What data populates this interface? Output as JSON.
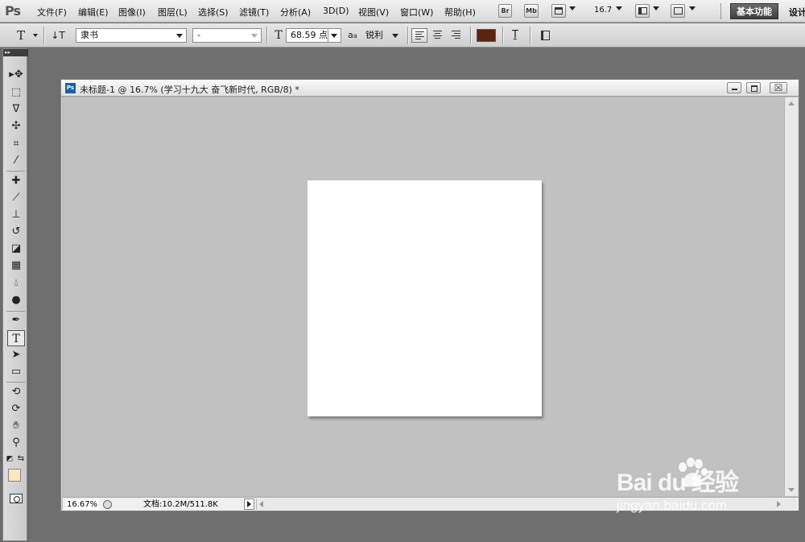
{
  "app": {
    "logo": "Ps"
  },
  "menu": {
    "items": [
      {
        "label": "文件(F)"
      },
      {
        "label": "编辑(E)"
      },
      {
        "label": "图像(I)"
      },
      {
        "label": "图层(L)"
      },
      {
        "label": "选择(S)"
      },
      {
        "label": "滤镜(T)"
      },
      {
        "label": "分析(A)"
      },
      {
        "label": "3D(D)"
      },
      {
        "label": "视图(V)"
      },
      {
        "label": "窗口(W)"
      },
      {
        "label": "帮助(H)"
      }
    ],
    "bridge_label": "Br",
    "minibridge_label": "Mb",
    "zoom_value": "16.7",
    "workspace_label": "基本功能",
    "design_label": "设计"
  },
  "options": {
    "tool_glyph": "T",
    "font_family": "隶书",
    "font_style": "-",
    "font_size": "68.59 点",
    "aa_label": "a",
    "aa_sub": "a",
    "antialias": "锐利",
    "text_color": "#5c2410"
  },
  "document": {
    "ps_icon": "Ps",
    "title": "未标题-1 @ 16.7% (学习十九大  奋飞新时代, RGB/8) *",
    "close_glyph": "☒",
    "zoom": "16.67%",
    "doc_info": "文档:10.2M/511.8K"
  },
  "colors": {
    "foreground": "#fce5bf",
    "background": "#ffffff"
  },
  "watermark": {
    "brand": "Bai  du 经验",
    "site": "jingyan.baidu.com"
  }
}
